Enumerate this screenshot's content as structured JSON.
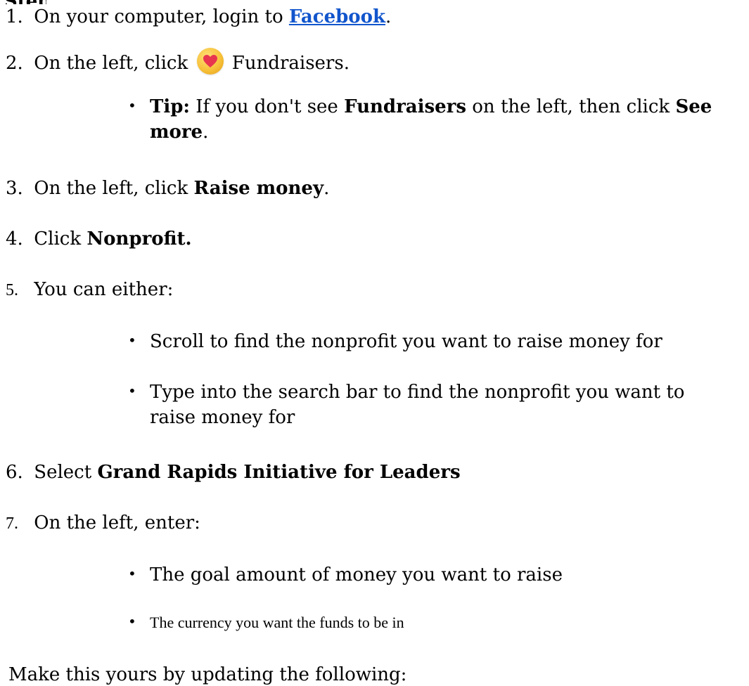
{
  "steps": {
    "s1": {
      "num": "1.",
      "pre": "On your computer, login to ",
      "link": "Facebook",
      "post": "."
    },
    "s2": {
      "num": "2.",
      "pre": "On the left, click",
      "post": " Fundraisers."
    },
    "tip": {
      "label": "Tip:",
      "t1": " If you don't see ",
      "b1": "Fundraisers",
      "t2": " on the left, then click ",
      "b2": "See",
      "b3": "more",
      "t3": "."
    },
    "s3": {
      "num": "3.",
      "pre": "On the left, click ",
      "bold": "Raise money",
      "post": "."
    },
    "s4": {
      "num": "4.",
      "pre": "Click ",
      "bold": "Nonprofit."
    },
    "s5": {
      "num": "5.",
      "text": "You can either:"
    },
    "s5b1": "Scroll to find the nonprofit you want to raise money for",
    "s5b2a": "Type into the search bar to find the nonprofit you want to",
    "s5b2b": "raise money for",
    "s6": {
      "num": "6.",
      "pre": "Select ",
      "bold": "Grand Rapids Initiative for Leaders"
    },
    "s7": {
      "num": "7.",
      "text": "On the left, enter:"
    },
    "s7b1": "The goal amount of money you want to raise",
    "s7b2": "The currency you want the funds to be in",
    "footer": "Make this yours by updating the following:"
  },
  "icons": {
    "fundraisers": "heart-icon",
    "bullet": "bullet-dot"
  },
  "colors": {
    "link": "#1155cc",
    "icon_bg": "#f7c23a",
    "heart": "#e8364f"
  }
}
